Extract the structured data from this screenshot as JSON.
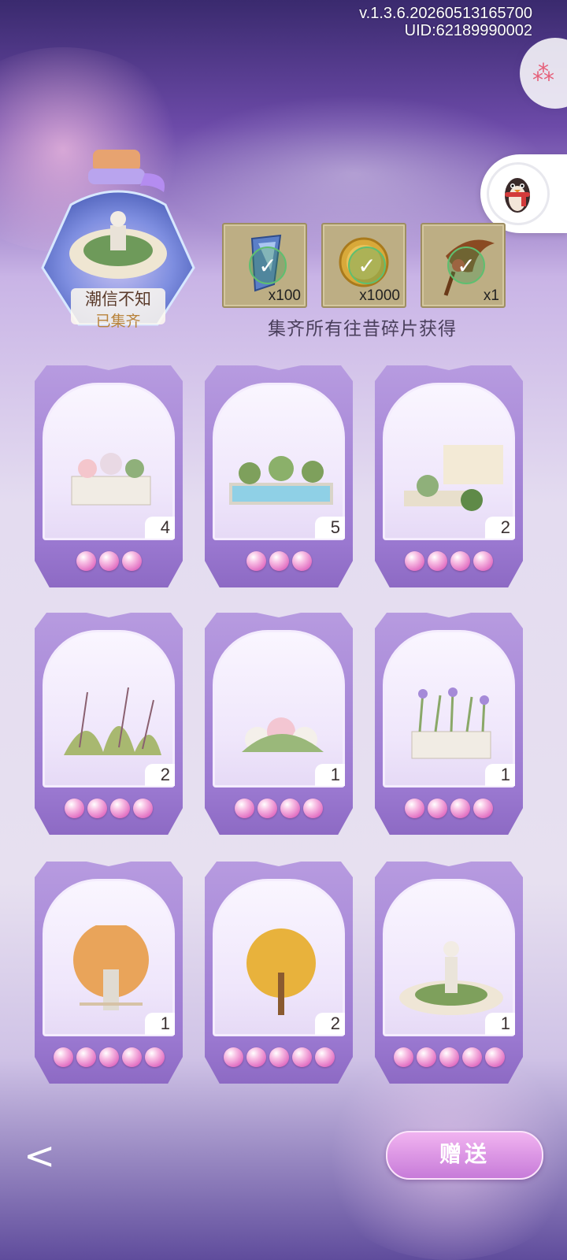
{
  "header": {
    "version": "v.1.3.6.20260513165700",
    "uid": "UID:62189990002"
  },
  "collection": {
    "name": "潮信不知",
    "status": "已集齐"
  },
  "rewards": [
    {
      "icon": "blue-gem-icon",
      "qty": "x100"
    },
    {
      "icon": "clover-coin-icon",
      "qty": "x1000"
    },
    {
      "icon": "cornucopia-icon",
      "qty": "x1"
    }
  ],
  "reward_caption": "集齐所有往昔碎片获得",
  "cards": [
    {
      "art": "flower-planter-art",
      "count": "4",
      "pearls": 3
    },
    {
      "art": "fountain-pool-art",
      "count": "5",
      "pearls": 3
    },
    {
      "art": "garden-wall-art",
      "count": "2",
      "pearls": 4
    },
    {
      "art": "wild-grass-art",
      "count": "2",
      "pearls": 4
    },
    {
      "art": "flower-bush-art",
      "count": "1",
      "pearls": 4
    },
    {
      "art": "iris-planter-art",
      "count": "1",
      "pearls": 4
    },
    {
      "art": "autumn-banyan-art",
      "count": "1",
      "pearls": 5
    },
    {
      "art": "yellow-maple-art",
      "count": "2",
      "pearls": 5
    },
    {
      "art": "statue-garden-art",
      "count": "1",
      "pearls": 5
    }
  ],
  "footer": {
    "gift_label": "赠送"
  },
  "colors": {
    "card_frame": "#9a78d0",
    "pearl": "#e477c6",
    "gift_button": "#c77bd9"
  }
}
